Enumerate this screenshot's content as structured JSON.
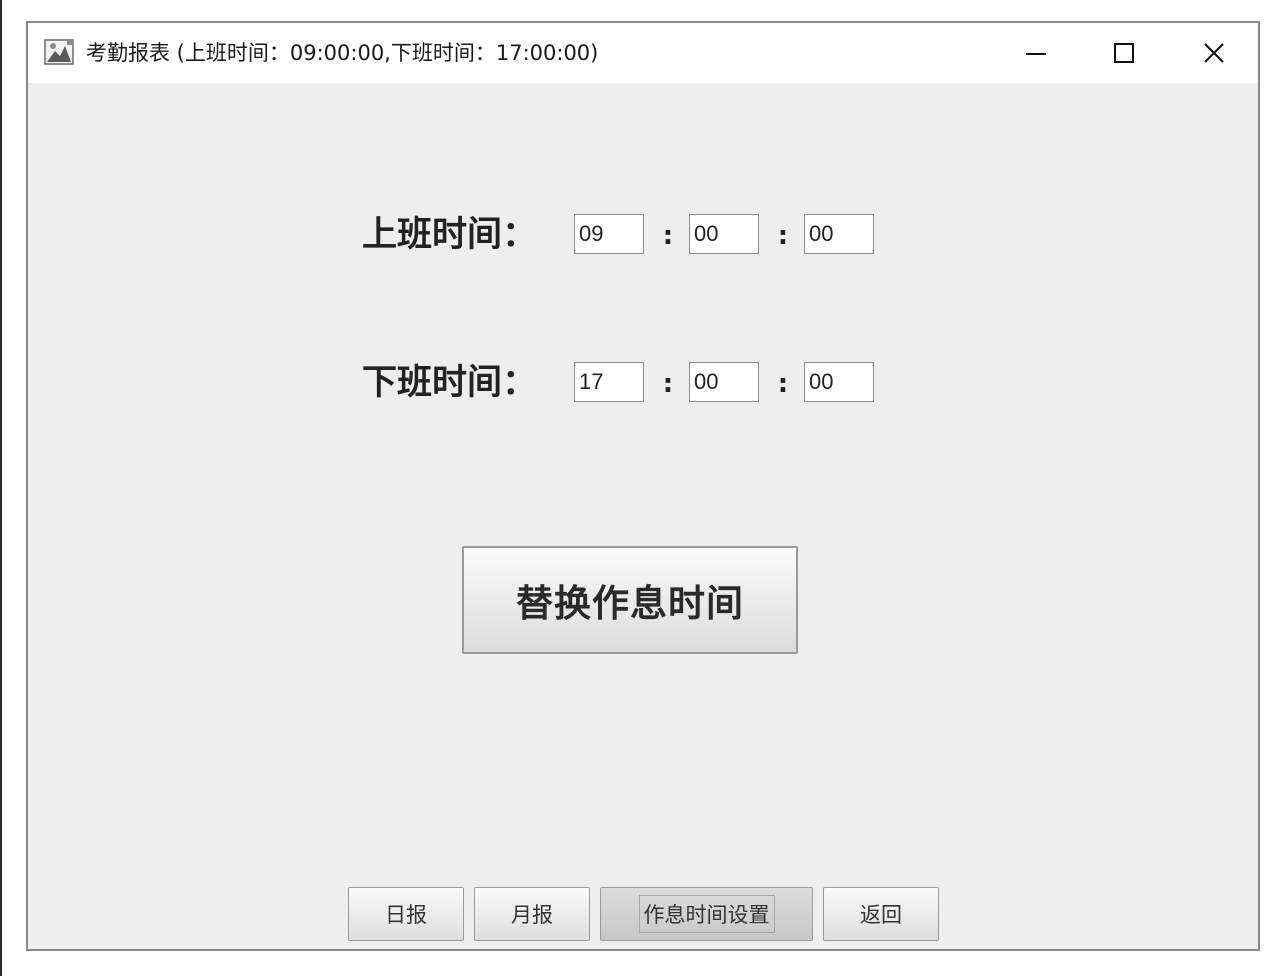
{
  "window": {
    "title": "考勤报表 (上班时间：09:00:00,下班时间：17:00:00)",
    "icons": {
      "app": "app-icon",
      "minimize": "minimize-icon",
      "maximize": "maximize-icon",
      "close": "close-icon"
    }
  },
  "form": {
    "start": {
      "label": "上班时间：",
      "hour": "09",
      "minute": "00",
      "second": "00"
    },
    "end": {
      "label": "下班时间：",
      "hour": "17",
      "minute": "00",
      "second": "00"
    },
    "separator": ":"
  },
  "actions": {
    "replace_label": "替换作息时间"
  },
  "nav": {
    "daily": "日报",
    "monthly": "月报",
    "schedule": "作息时间设置",
    "back": "返回"
  }
}
